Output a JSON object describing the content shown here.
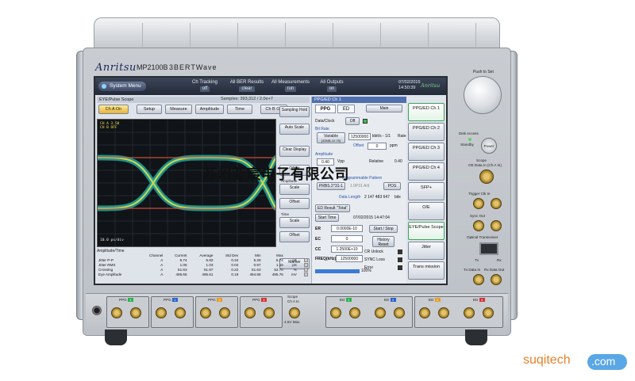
{
  "device": {
    "brand": "Anritsu",
    "model": "MP2100B",
    "series": "BERTWave",
    "right_panel": {
      "knob_label": "Push to Set",
      "disk_access": "Disk Access",
      "standby": "Standby",
      "power": "Power",
      "scope_label": "Scope",
      "scope_sub": "OE Data In (Ch A In)",
      "trigger_label": "Trigger Clk In",
      "sync_out": "Sync Out",
      "optical_label": "Optical Transceiver",
      "tx": "Tx",
      "rx": "Rx",
      "tx_data_in": "Tx Data In",
      "rx_data_out": "Rx Data Out"
    },
    "bottom": {
      "groups": [
        {
          "label": "PPG",
          "ch": "1",
          "color": "#2db24c"
        },
        {
          "label": "PPG",
          "ch": "2",
          "color": "#2a63c9"
        },
        {
          "label": "PPG",
          "ch": "3",
          "color": "#e59b26"
        },
        {
          "label": "PPG",
          "ch": "4",
          "color": "#d6333a"
        }
      ],
      "scope_group": "Scope",
      "scope_sub": "Ch A In",
      "scope_max": "4.5V Max",
      "ed_groups": [
        {
          "label": "ED",
          "ch": "1",
          "color": "#2db24c"
        },
        {
          "label": "ED",
          "ch": "2",
          "color": "#2a63c9"
        },
        {
          "label": "ED",
          "ch": "3",
          "color": "#e59b26"
        },
        {
          "label": "ED",
          "ch": "4",
          "color": "#d6333a"
        }
      ]
    }
  },
  "screen": {
    "system_menu": "System Menu",
    "top_buttons": [
      {
        "label": "Ch Tracking",
        "sub": "off"
      },
      {
        "label": "All BER Results",
        "sub": "clear"
      },
      {
        "label": "All Measurements",
        "sub": "run"
      },
      {
        "label": "All Outputs",
        "sub": "on"
      }
    ],
    "datetime": [
      "07/02/2015",
      "14:50:39"
    ],
    "logo": "Anritsu",
    "eye_panel": {
      "title": "EYE/Pulse Scope",
      "samples": "Samples: 393,312 / 2.0e+7",
      "tools": [
        "Ch A On",
        "Setup",
        "Measure",
        "Amplitude",
        "Time",
        "Ch B Off"
      ],
      "side_buttons": [
        "Sampling Hold",
        "Auto Scale",
        "Clear Display",
        "Offset",
        "Scale",
        "Offset",
        "Scale",
        "Offset",
        "Marker"
      ],
      "side_labels": [
        "Amplitude",
        "Time"
      ],
      "scope_ch": "CH A 3.50\nCH B OFF",
      "scope_scale": "10.0 ps/div",
      "stats_title": "Amplitude/Time",
      "stats_headers": [
        "",
        "Channel",
        "Current",
        "Average",
        "Std Dev",
        "Min",
        "Max",
        ""
      ],
      "stats_rows": [
        [
          "Jitter P-P",
          "A",
          "6.74",
          "5.93",
          "0.34",
          "5.29",
          "6.74",
          "pS"
        ],
        [
          "Jitter RMS",
          "A",
          "1.06",
          "1.03",
          "0.04",
          "0.97",
          "1.15",
          "pS"
        ],
        [
          "Crossing",
          "A",
          "51.63",
          "51.67",
          "0.22",
          "51.63",
          "52.70",
          "%"
        ],
        [
          "Eye Amplitude",
          "A",
          "495.66",
          "495.61",
          "0.19",
          "494.86",
          "495.76",
          "mV"
        ]
      ]
    },
    "ppg_panel": {
      "title": "PPG/ED Ch 1",
      "tabs": [
        "PPG",
        "ED"
      ],
      "main_btn": "Main",
      "data_clock_label": "Data/Clock",
      "data_clock_value": "Off",
      "bit_rate_label": "Bit Rate",
      "variable_btn": "Variable",
      "variable_sub": "(32MB-12.75)",
      "bit_rate_value": "12500000",
      "bit_rate_unit": "kbit/s - 1/1",
      "bit_rate_ratio": "Rate",
      "offset_label": "Offset",
      "offset_value": "0",
      "offset_unit": "ppm",
      "amplitude_label": "Amplitude",
      "amplitude_value": "0.40",
      "amplitude_unit": "Vpp",
      "relative_label": "Relative",
      "relative_value": "0.40",
      "pattern_label": "Programmable Pattern",
      "prbs_btn": "PRBS 2^31-1",
      "pattern_field": "1.0P31 A/d",
      "pos_btn": "POS",
      "data_length_label": "Data Length",
      "data_length_value": "2 147 483 647",
      "data_length_unit": "bits",
      "ed_result": "ED Result \"Total\"",
      "start_time_btn": "Start Time",
      "start_time_value": "07/02/2015 14:47:04",
      "er_label": "ER",
      "er_value": "0.0000E-10",
      "start_stop_btn": "Start / Stop",
      "ec_label": "EC",
      "ec_value": "0",
      "history_btn": "History Reset",
      "cc_label": "CC",
      "cc_value": "1.2500E+10",
      "cr_unlock": "CR Unlock",
      "sync_loss": "SYNC Loss",
      "error": "Error",
      "freq_label": "FREQ(kHz)",
      "freq_value": "12500000",
      "progress_percent": 100,
      "progress_label": "100%"
    },
    "right_nav": [
      {
        "label": "PPG/ED Ch 1",
        "selected": true
      },
      {
        "label": "PPG/ED Ch 2",
        "selected": false
      },
      {
        "label": "PPG/ED Ch 3",
        "selected": false
      },
      {
        "label": "PPG/ED Ch 4",
        "selected": false
      },
      {
        "label": "SFP+",
        "selected": false
      },
      {
        "label": "O/E",
        "selected": false
      },
      {
        "label": "EYE/Pulse Scope",
        "selected": true
      },
      {
        "label": "Jitter",
        "selected": false
      },
      {
        "label": "Trans mission",
        "selected": false
      }
    ]
  },
  "watermark": {
    "chinese": "苏州亚宸电子有限公司",
    "logo_text": "suqitech",
    "logo_domain": ".com"
  }
}
